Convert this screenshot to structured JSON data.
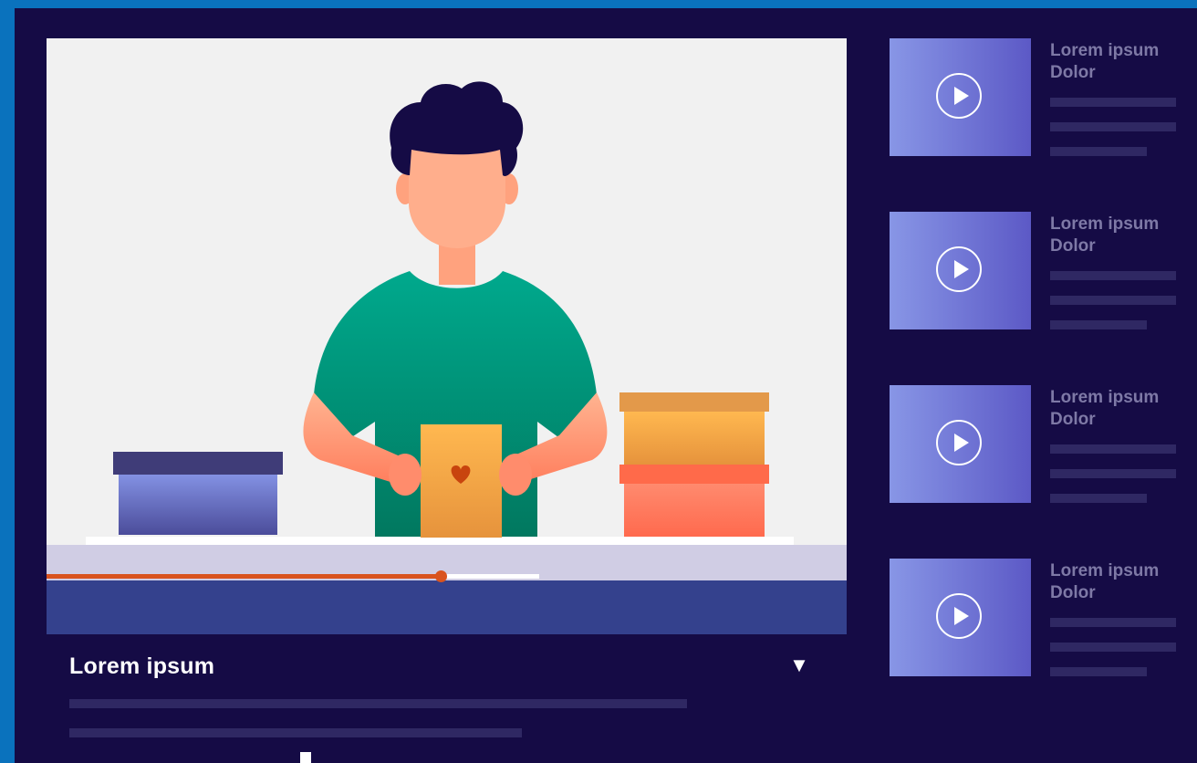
{
  "player": {
    "title": "Lorem ipsum",
    "progress": 0.8,
    "expand_icon": "triangle-down-icon"
  },
  "playlist": [
    {
      "title": "Lorem ipsum Dolor",
      "icon": "play-icon"
    },
    {
      "title": "Lorem ipsum Dolor",
      "icon": "play-icon"
    },
    {
      "title": "Lorem ipsum Dolor",
      "icon": "play-icon"
    },
    {
      "title": "Lorem ipsum Dolor",
      "icon": "play-icon"
    }
  ],
  "colors": {
    "background": "#150b45",
    "frame": "#0a72bd",
    "progress": "#d9531e",
    "controls": "#34418d",
    "thumbnail_start": "#8896e6",
    "thumbnail_end": "#5c59c6"
  }
}
